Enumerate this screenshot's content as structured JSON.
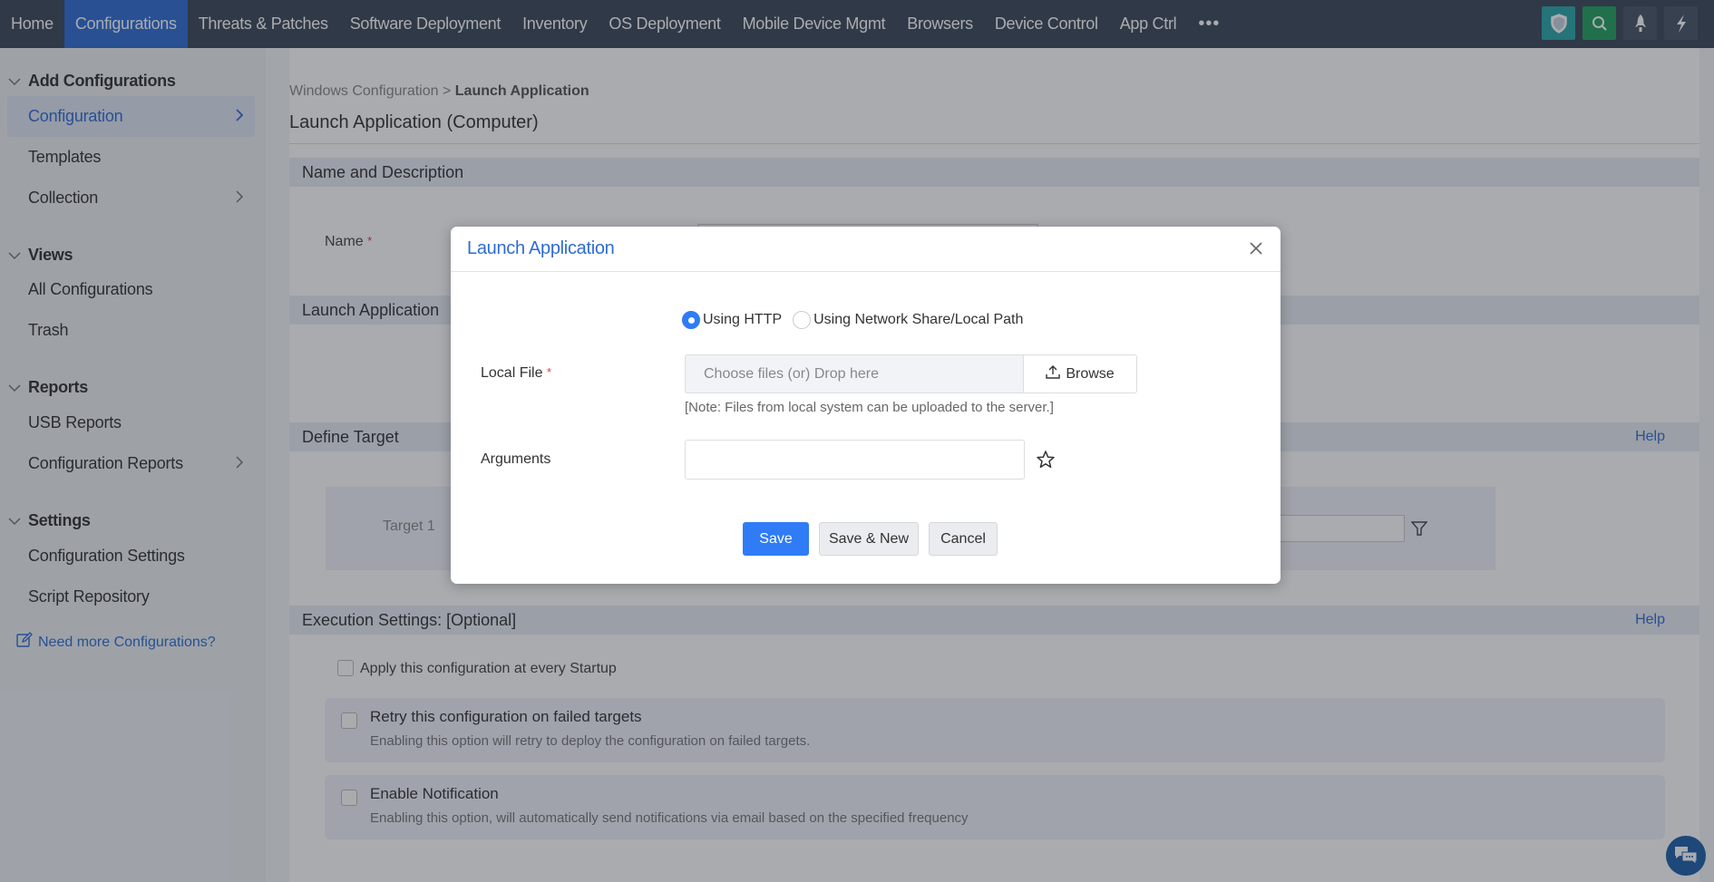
{
  "topnav": {
    "tabs": [
      {
        "label": "Home",
        "active": false
      },
      {
        "label": "Configurations",
        "active": true
      },
      {
        "label": "Threats & Patches",
        "active": false
      },
      {
        "label": "Software Deployment",
        "active": false
      },
      {
        "label": "Inventory",
        "active": false
      },
      {
        "label": "OS Deployment",
        "active": false
      },
      {
        "label": "Mobile Device Mgmt",
        "active": false
      },
      {
        "label": "Browsers",
        "active": false
      },
      {
        "label": "Device Control",
        "active": false
      },
      {
        "label": "App Ctrl",
        "active": false
      }
    ],
    "more_label": "•••",
    "right_icons": [
      "shield-icon",
      "search-icon",
      "rocket-icon",
      "lightning-icon"
    ],
    "active_color": "#2f6cd2"
  },
  "sidebar": {
    "groups": [
      {
        "label": "Add Configurations",
        "items": [
          {
            "label": "Configuration",
            "active": true,
            "has_arrow": true
          },
          {
            "label": "Templates",
            "active": false,
            "has_arrow": false
          },
          {
            "label": "Collection",
            "active": false,
            "has_arrow": true
          }
        ]
      },
      {
        "label": "Views",
        "items": [
          {
            "label": "All Configurations",
            "active": false,
            "has_arrow": false
          },
          {
            "label": "Trash",
            "active": false,
            "has_arrow": false
          }
        ]
      },
      {
        "label": "Reports",
        "items": [
          {
            "label": "USB Reports",
            "active": false,
            "has_arrow": false
          },
          {
            "label": "Configuration Reports",
            "active": false,
            "has_arrow": true
          }
        ]
      },
      {
        "label": "Settings",
        "items": [
          {
            "label": "Configuration Settings",
            "active": false,
            "has_arrow": false
          },
          {
            "label": "Script Repository",
            "active": false,
            "has_arrow": false
          }
        ]
      }
    ],
    "need_more_link": "Need more Configurations?"
  },
  "page": {
    "breadcrumb_parent": "Windows Configuration",
    "breadcrumb_separator": ">",
    "breadcrumb_current": "Launch Application",
    "title": "Launch Application (Computer)",
    "sections": {
      "name_desc": "Name and Description",
      "name_label": "Name",
      "required_mark": "*",
      "launch_app": "Launch Application",
      "define_target": "Define Target",
      "target_label": "Target 1",
      "execution": "Execution Settings: [Optional]",
      "help": "Help"
    },
    "execution_options": {
      "startup": "Apply this configuration at every Startup",
      "retry_title": "Retry this configuration on failed targets",
      "retry_desc": "Enabling this option will retry to deploy the configuration on failed targets.",
      "notify_title": "Enable Notification",
      "notify_desc": "Enabling this option, will automatically send notifications via email based on the specified frequency"
    }
  },
  "modal": {
    "title": "Launch Application",
    "radio_options": [
      {
        "label": "Using HTTP",
        "checked": true
      },
      {
        "label": "Using Network Share/Local Path",
        "checked": false
      }
    ],
    "local_file_label": "Local File",
    "required_mark": "*",
    "file_placeholder": "Choose files (or) Drop here",
    "browse_label": "Browse",
    "note": "[Note: Files from local system can be uploaded to the server.]",
    "arguments_label": "Arguments",
    "arguments_value": "",
    "buttons": {
      "save": "Save",
      "save_new": "Save & New",
      "cancel": "Cancel"
    },
    "primary_color": "#2f7cf6"
  }
}
